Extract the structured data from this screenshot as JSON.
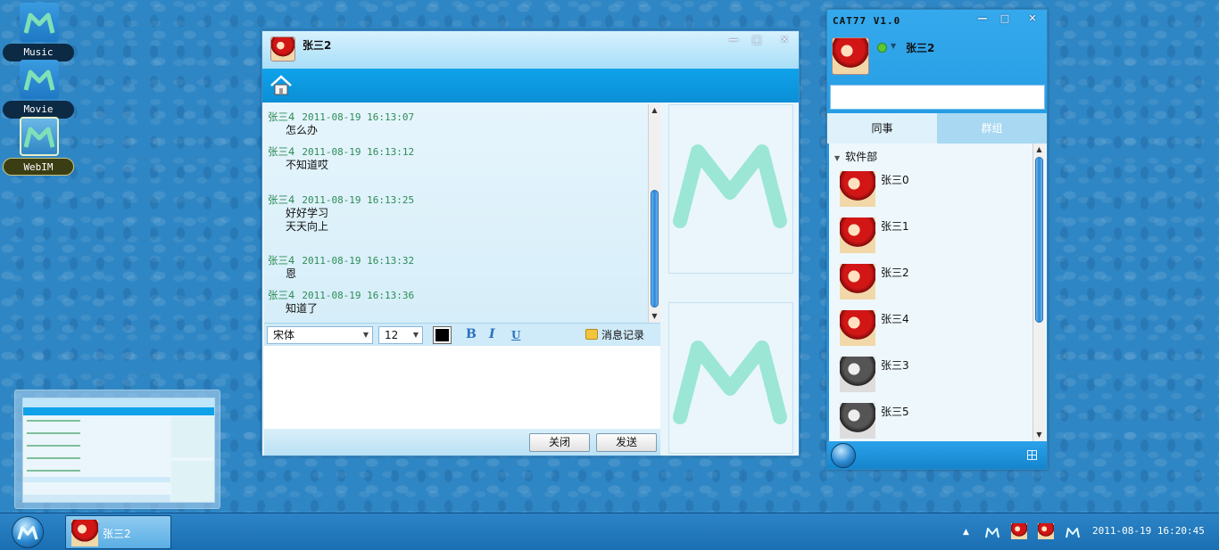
{
  "desktop": {
    "icons": [
      {
        "label": "Music"
      },
      {
        "label": "Movie"
      },
      {
        "label": "WebIM"
      }
    ]
  },
  "chat_window": {
    "title": "张三2",
    "messages": [
      {
        "sender": "张三4",
        "time": "2011-08-19 16:13:07",
        "lines": [
          "怎么办"
        ]
      },
      {
        "sender": "张三4",
        "time": "2011-08-19 16:13:12",
        "lines": [
          "不知道哎"
        ]
      },
      {
        "sender": "张三4",
        "time": "2011-08-19 16:13:25",
        "lines": [
          "好好学习",
          "天天向上"
        ]
      },
      {
        "sender": "张三4",
        "time": "2011-08-19 16:13:32",
        "lines": [
          "恩"
        ]
      },
      {
        "sender": "张三4",
        "time": "2011-08-19 16:13:36",
        "lines": [
          "知道了"
        ]
      }
    ],
    "font_select": "宋体",
    "size_select": "12",
    "font_color": "#000000",
    "bold_label": "B",
    "italic_label": "I",
    "underline_label": "U",
    "history_label": "消息记录",
    "close_button": "关闭",
    "send_button": "发送",
    "accent_color": "#0b8fd6"
  },
  "buddy_window": {
    "app_title": "CAT77 V1.0",
    "my_name": "张三2",
    "status_color": "#5bc736",
    "search_value": "",
    "tabs": [
      {
        "label": "同事",
        "active": true
      },
      {
        "label": "群组",
        "active": false
      }
    ],
    "group_name": "软件部",
    "contacts": [
      {
        "name": "张三0",
        "online": true
      },
      {
        "name": "张三1",
        "online": true
      },
      {
        "name": "张三2",
        "online": true
      },
      {
        "name": "张三4",
        "online": true
      },
      {
        "name": "张三3",
        "online": false
      },
      {
        "name": "张三5",
        "online": false
      }
    ]
  },
  "taskbar": {
    "task_label": "张三2",
    "tray_caret": "▲",
    "clock": "2011-08-19 16:20:45"
  }
}
